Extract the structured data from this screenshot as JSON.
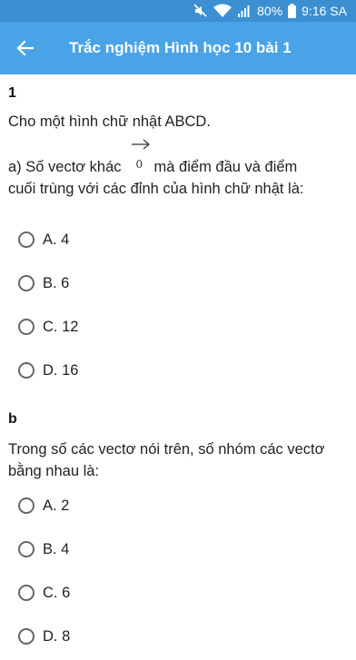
{
  "status_bar": {
    "battery": "80%",
    "time": "9:16 SA",
    "icons": [
      "mute-icon",
      "wifi-icon",
      "signal-icon",
      "battery-icon"
    ]
  },
  "app_bar": {
    "title": "Trắc nghiệm Hình học 10 bài 1",
    "back_icon": "arrow-left-icon"
  },
  "questions": [
    {
      "number": "1",
      "intro": "Cho một hình chữ nhật ABCD.",
      "text_before_vector": "a) Số vectơ khác",
      "vector_symbol": "0",
      "text_after_vector": "mà điểm đầu và điểm",
      "text_line2": "cuối trùng với các đỉnh của hình chữ nhật là:",
      "options": [
        "A. 4",
        "B. 6",
        "C. 12",
        "D. 16"
      ]
    },
    {
      "number": "b",
      "text": "Trong số các vectơ nói trên, số nhóm các vectơ bằng nhau là:",
      "options": [
        "A. 2",
        "B. 4",
        "C. 6",
        "D. 8"
      ]
    }
  ],
  "colors": {
    "status_bar": "#3c8fd0",
    "app_bar": "#4aa3e6",
    "radio_border": "#666666"
  }
}
